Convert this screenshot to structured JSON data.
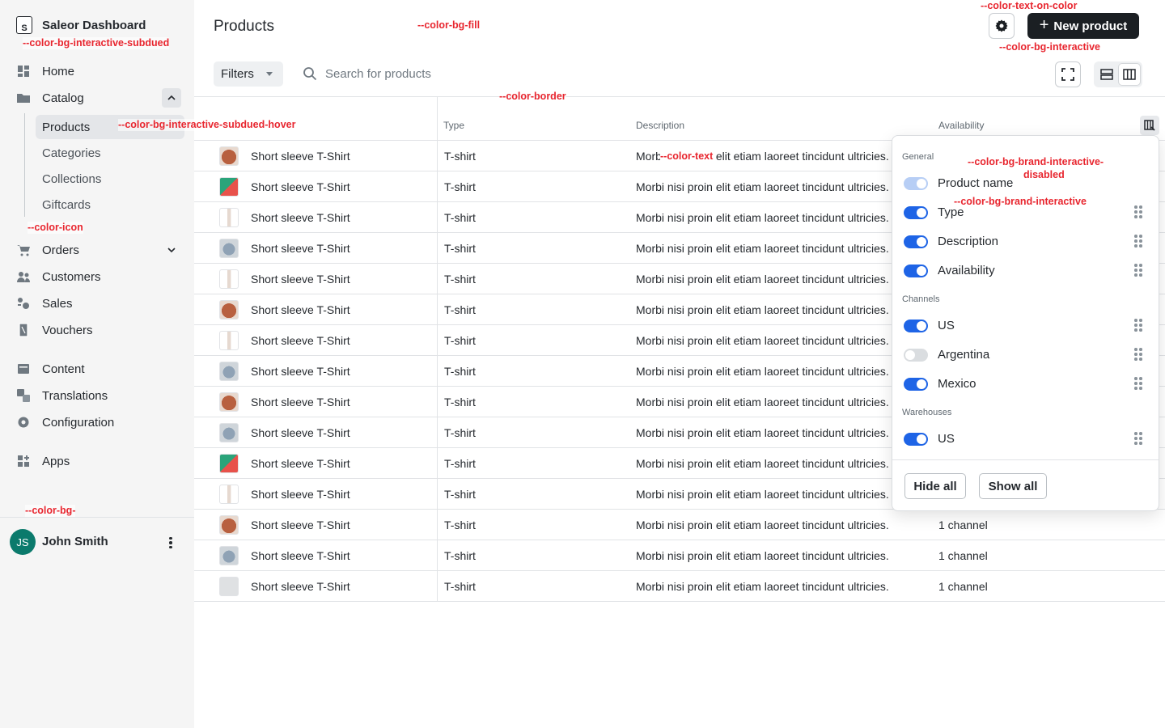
{
  "sidebar": {
    "brand": "Saleor Dashboard",
    "brand_logo": "S",
    "items": [
      {
        "label": "Home",
        "icon": "home-icon"
      },
      {
        "label": "Catalog",
        "icon": "folder-icon"
      },
      {
        "label": "Orders",
        "icon": "cart-icon"
      },
      {
        "label": "Customers",
        "icon": "users-icon"
      },
      {
        "label": "Sales",
        "icon": "percent-icon"
      },
      {
        "label": "Vouchers",
        "icon": "voucher-icon"
      },
      {
        "label": "Content",
        "icon": "content-icon"
      },
      {
        "label": "Translations",
        "icon": "translate-icon"
      },
      {
        "label": "Configuration",
        "icon": "gear-icon"
      },
      {
        "label": "Apps",
        "icon": "apps-icon"
      }
    ],
    "catalog_sub": [
      "Products",
      "Categories",
      "Collections",
      "Giftcards"
    ],
    "active_sub": "Products",
    "user": {
      "initials": "JS",
      "name": "John Smith",
      "avatar_color": "#0b7a6c"
    }
  },
  "header": {
    "title": "Products",
    "new_button": "New product",
    "plus": "+"
  },
  "toolbar": {
    "filters": "Filters",
    "search_placeholder": "Search for products"
  },
  "grid": {
    "columns": [
      "",
      "Type",
      "Description",
      "Availability"
    ],
    "rows": [
      {
        "name": "Short sleeve T-Shirt",
        "type": "T-shirt",
        "desc": "Morbi nisi proin elit etiam laoreet tincidunt ultricies.",
        "avail": "",
        "thumb": "orange"
      },
      {
        "name": "Short sleeve T-Shirt",
        "type": "T-shirt",
        "desc": "Morbi nisi proin elit etiam laoreet tincidunt ultricies.",
        "avail": "",
        "thumb": "geo"
      },
      {
        "name": "Short sleeve T-Shirt",
        "type": "T-shirt",
        "desc": "Morbi nisi proin elit etiam laoreet tincidunt ultricies.",
        "avail": "",
        "thumb": "white"
      },
      {
        "name": "Short sleeve T-Shirt",
        "type": "T-shirt",
        "desc": "Morbi nisi proin elit etiam laoreet tincidunt ultricies.",
        "avail": "",
        "thumb": "grey"
      },
      {
        "name": "Short sleeve T-Shirt",
        "type": "T-shirt",
        "desc": "Morbi nisi proin elit etiam laoreet tincidunt ultricies.",
        "avail": "",
        "thumb": "white"
      },
      {
        "name": "Short sleeve T-Shirt",
        "type": "T-shirt",
        "desc": "Morbi nisi proin elit etiam laoreet tincidunt ultricies.",
        "avail": "",
        "thumb": "orange"
      },
      {
        "name": "Short sleeve T-Shirt",
        "type": "T-shirt",
        "desc": "Morbi nisi proin elit etiam laoreet tincidunt ultricies.",
        "avail": "",
        "thumb": "white"
      },
      {
        "name": "Short sleeve T-Shirt",
        "type": "T-shirt",
        "desc": "Morbi nisi proin elit etiam laoreet tincidunt ultricies.",
        "avail": "",
        "thumb": "grey"
      },
      {
        "name": "Short sleeve T-Shirt",
        "type": "T-shirt",
        "desc": "Morbi nisi proin elit etiam laoreet tincidunt ultricies.",
        "avail": "",
        "thumb": "orange"
      },
      {
        "name": "Short sleeve T-Shirt",
        "type": "T-shirt",
        "desc": "Morbi nisi proin elit etiam laoreet tincidunt ultricies.",
        "avail": "",
        "thumb": "grey"
      },
      {
        "name": "Short sleeve T-Shirt",
        "type": "T-shirt",
        "desc": "Morbi nisi proin elit etiam laoreet tincidunt ultricies.",
        "avail": "",
        "thumb": "geo"
      },
      {
        "name": "Short sleeve T-Shirt",
        "type": "T-shirt",
        "desc": "Morbi nisi proin elit etiam laoreet tincidunt ultricies.",
        "avail": "",
        "thumb": "white"
      },
      {
        "name": "Short sleeve T-Shirt",
        "type": "T-shirt",
        "desc": "Morbi nisi proin elit etiam laoreet tincidunt ultricies.",
        "avail": "1 channel",
        "thumb": "orange"
      },
      {
        "name": "Short sleeve T-Shirt",
        "type": "T-shirt",
        "desc": "Morbi nisi proin elit etiam laoreet tincidunt ultricies.",
        "avail": "1 channel",
        "thumb": "grey"
      },
      {
        "name": "Short sleeve T-Shirt",
        "type": "T-shirt",
        "desc": "Morbi nisi proin elit etiam laoreet tincidunt ultricies.",
        "avail": "1 channel",
        "thumb": "blank"
      }
    ]
  },
  "column_picker": {
    "sections": [
      {
        "title": "General",
        "items": [
          {
            "label": "Product name",
            "state": "disabled",
            "draggable": false
          },
          {
            "label": "Type",
            "state": "on",
            "draggable": true
          },
          {
            "label": "Description",
            "state": "on",
            "draggable": true
          },
          {
            "label": "Availability",
            "state": "on",
            "draggable": true
          }
        ]
      },
      {
        "title": "Channels",
        "items": [
          {
            "label": "US",
            "state": "on",
            "draggable": true
          },
          {
            "label": "Argentina",
            "state": "off",
            "draggable": true
          },
          {
            "label": "Mexico",
            "state": "on",
            "draggable": true
          }
        ]
      },
      {
        "title": "Warehouses",
        "items": [
          {
            "label": "US",
            "state": "on",
            "draggable": true
          }
        ]
      }
    ],
    "hide_all": "Hide all",
    "show_all": "Show all"
  },
  "annotations": [
    {
      "text": "--color-text-on-color"
    },
    {
      "text": "--color-bg-interactive-subdued"
    },
    {
      "text": "--color-bg-fill"
    },
    {
      "text": "--color-bg-interactive"
    },
    {
      "text": "--color-border"
    },
    {
      "text": "--color-bg-interactive-subdued-hover"
    },
    {
      "text": "--color-text"
    },
    {
      "text": "--color-bg-brand-interactive-"
    },
    {
      "text": "disabled"
    },
    {
      "text": "--color-bg-brand-interactive"
    },
    {
      "text": "--color-icon"
    },
    {
      "text": "--color-bg-"
    }
  ],
  "colors": {
    "accent": "#1e64e6",
    "primary_button": "#1b1f23",
    "annotation": "#e8262f",
    "sidebar_bg": "#f5f5f5"
  }
}
